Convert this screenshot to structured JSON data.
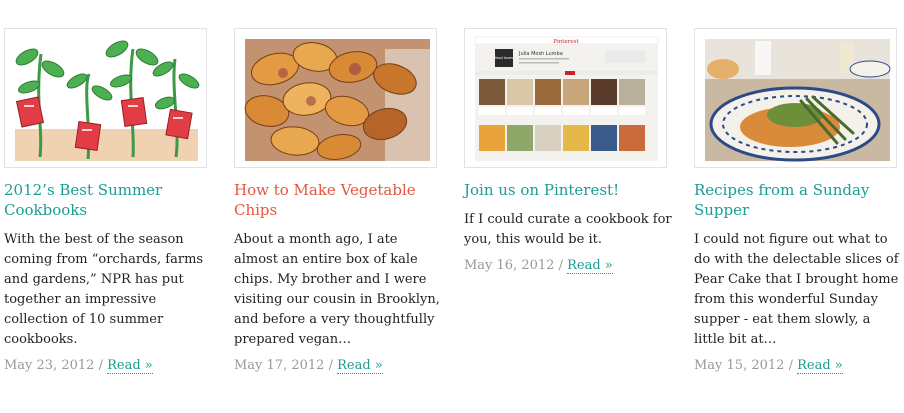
{
  "posts": [
    {
      "title": "2012’s Best Summer Cookbooks",
      "title_color": "#1a9e93",
      "excerpt": "With the best of the season coming from “orchards, farms and gardens,” NPR has put together an impressive collection of 10 summer cookbooks.",
      "date": "May 23, 2012",
      "separator": " / ",
      "read_more": "Read »",
      "image_icon": "cookbook-plants-illustration"
    },
    {
      "title": "How to Make Vegetable Chips",
      "title_color": "#e4573d",
      "excerpt": "About a month ago, I ate almost an entire box of kale chips. My brother and I were visiting our cousin in Brooklyn, and before a very thoughtfully prepared vegan…",
      "date": "May 17, 2012",
      "separator": " / ",
      "read_more": "Read »",
      "image_icon": "vegetable-chips-photo"
    },
    {
      "title": "Join us on Pinterest!",
      "title_color": "#1a9e93",
      "excerpt": "If I could curate a cookbook for you, this would be it.",
      "date": "May 16, 2012",
      "separator": " / ",
      "read_more": "Read »",
      "image_icon": "pinterest-board-screenshot",
      "pinterest": {
        "logo": "Pinterest",
        "profile_name": "Julia Mosh Lumba",
        "avatar_text": "food loves"
      }
    },
    {
      "title": "Recipes from a Sunday Supper",
      "title_color": "#1a9e93",
      "excerpt": "I could not figure out what to do with the delectable slices of Pear Cake that I brought home from this wonderful Sunday supper - eat them slowly, a little bit at…",
      "date": "May 15, 2012",
      "separator": " / ",
      "read_more": "Read »",
      "image_icon": "sunday-supper-plate-photo"
    }
  ]
}
